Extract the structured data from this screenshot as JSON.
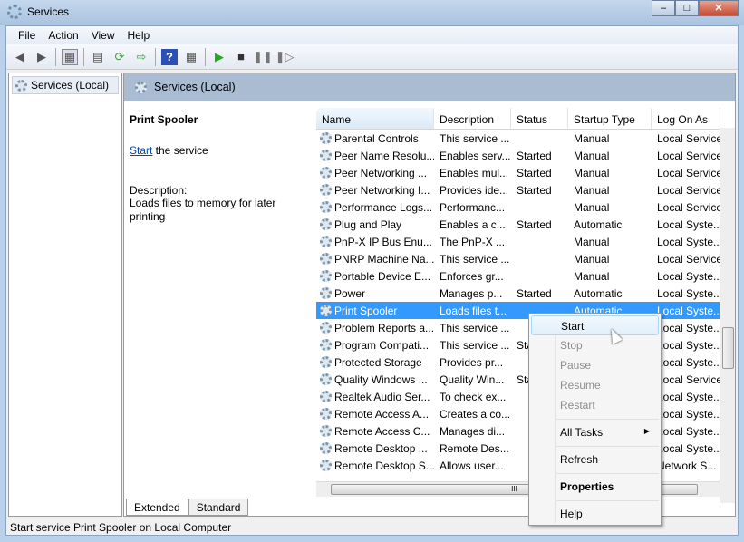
{
  "window": {
    "title": "Services",
    "controls": [
      "minimize",
      "maximize",
      "close"
    ]
  },
  "menu": [
    "File",
    "Action",
    "View",
    "Help"
  ],
  "toolbar": [
    "back-icon",
    "forward-icon",
    "show-hide-tree-icon",
    "properties-icon",
    "refresh-icon",
    "export-icon",
    "help-icon",
    "action-pane-icon",
    "start-icon",
    "stop-icon",
    "pause-icon",
    "restart-icon"
  ],
  "tree": {
    "root": "Services (Local)"
  },
  "band": {
    "title": "Services (Local)"
  },
  "details": {
    "name": "Print Spooler",
    "start_link": "Start",
    "start_suffix": " the service",
    "desc_label": "Description:",
    "desc_text": "Loads files to memory for later printing"
  },
  "columns": [
    "Name",
    "Description",
    "Status",
    "Startup Type",
    "Log On As"
  ],
  "rows": [
    [
      "Parental Controls",
      "This service ...",
      "",
      "Manual",
      "Local Service"
    ],
    [
      "Peer Name Resolu...",
      "Enables serv...",
      "Started",
      "Manual",
      "Local Service"
    ],
    [
      "Peer Networking ...",
      "Enables mul...",
      "Started",
      "Manual",
      "Local Service"
    ],
    [
      "Peer Networking I...",
      "Provides ide...",
      "Started",
      "Manual",
      "Local Service"
    ],
    [
      "Performance Logs...",
      "Performanc...",
      "",
      "Manual",
      "Local Service"
    ],
    [
      "Plug and Play",
      "Enables a c...",
      "Started",
      "Automatic",
      "Local Syste..."
    ],
    [
      "PnP-X IP Bus Enu...",
      "The PnP-X ...",
      "",
      "Manual",
      "Local Syste..."
    ],
    [
      "PNRP Machine Na...",
      "This service ...",
      "",
      "Manual",
      "Local Service"
    ],
    [
      "Portable Device E...",
      "Enforces gr...",
      "",
      "Manual",
      "Local Syste..."
    ],
    [
      "Power",
      "Manages p...",
      "Started",
      "Automatic",
      "Local Syste..."
    ],
    [
      "Print Spooler",
      "Loads files t...",
      "",
      "Automatic",
      "Local Syste..."
    ],
    [
      "Problem Reports a...",
      "This service ...",
      "",
      "",
      "Local Syste..."
    ],
    [
      "Program Compati...",
      "This service ...",
      "Started",
      "",
      "Local Syste..."
    ],
    [
      "Protected Storage",
      "Provides pr...",
      "",
      "",
      "Local Syste..."
    ],
    [
      "Quality Windows ...",
      "Quality Win...",
      "Started",
      "",
      "Local Service"
    ],
    [
      "Realtek Audio Ser...",
      "To check ex...",
      "",
      "",
      "Local Syste..."
    ],
    [
      "Remote Access A...",
      "Creates a co...",
      "",
      "",
      "Local Syste..."
    ],
    [
      "Remote Access C...",
      "Manages di...",
      "",
      "",
      "Local Syste..."
    ],
    [
      "Remote Desktop ...",
      "Remote Des...",
      "",
      "",
      "Local Syste..."
    ],
    [
      "Remote Desktop S...",
      "Allows user...",
      "",
      "",
      "Network S..."
    ]
  ],
  "selected_row": "Print Spooler",
  "tabs": [
    "Extended",
    "Standard"
  ],
  "status": "Start service Print Spooler on Local Computer",
  "context_menu": {
    "start": "Start",
    "stop": "Stop",
    "pause": "Pause",
    "resume": "Resume",
    "restart": "Restart",
    "all_tasks": "All Tasks",
    "refresh": "Refresh",
    "properties": "Properties",
    "help": "Help"
  },
  "colors": {
    "selection": "#3399ff",
    "band": "#a9bcd1",
    "link": "#0645ad"
  }
}
